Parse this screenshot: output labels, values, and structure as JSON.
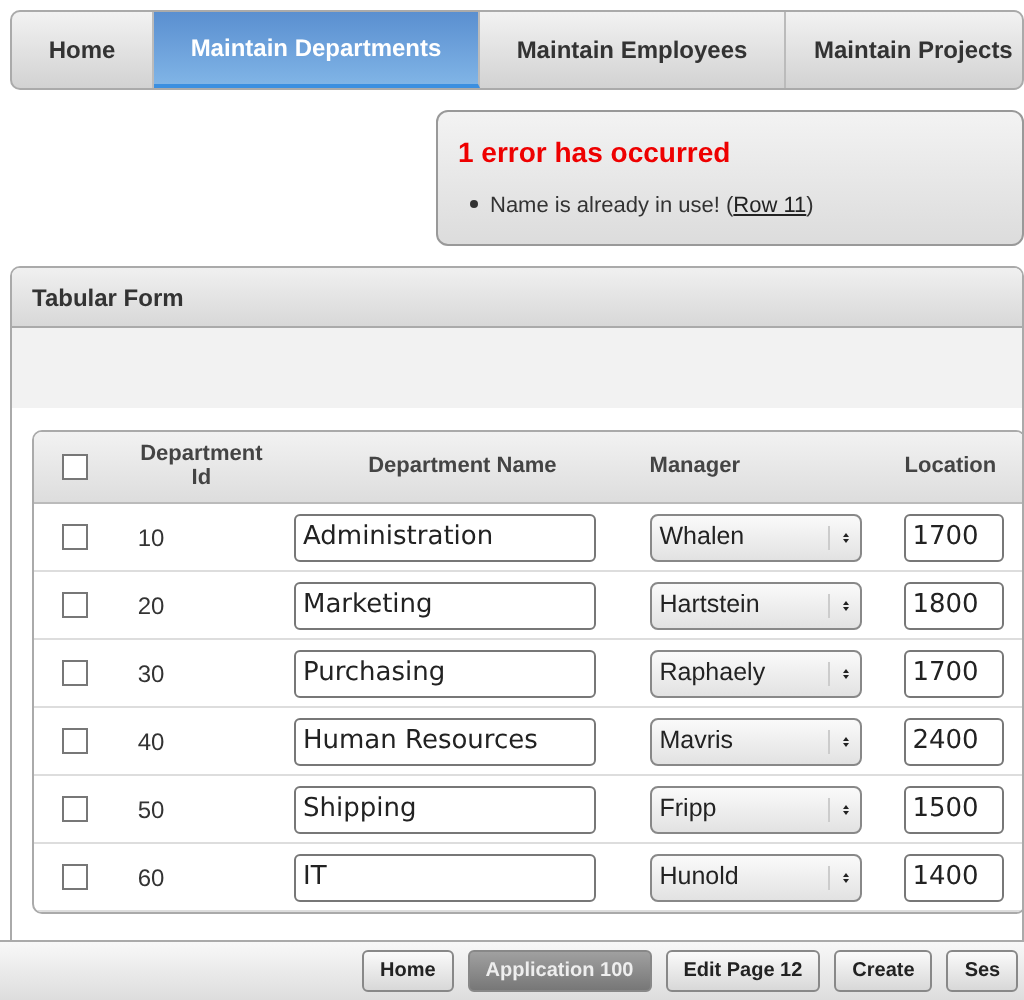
{
  "tabs": [
    {
      "label": "Home",
      "selected": false
    },
    {
      "label": "Maintain Departments",
      "selected": true
    },
    {
      "label": "Maintain Employees",
      "selected": false
    },
    {
      "label": "Maintain Projects",
      "selected": false
    }
  ],
  "error": {
    "title": "1 error has occurred",
    "messages": [
      {
        "text": "Name is already in use! (",
        "link": "Row 11",
        "after": ")"
      }
    ]
  },
  "region": {
    "title": "Tabular Form",
    "table": {
      "header_checked": false,
      "columns": [
        "Department Id",
        "Department Name",
        "Manager",
        "Location"
      ],
      "rows": [
        {
          "checked": false,
          "id": "10",
          "name": "Administration",
          "manager": "Whalen",
          "location": "1700"
        },
        {
          "checked": false,
          "id": "20",
          "name": "Marketing",
          "manager": "Hartstein",
          "location": "1800"
        },
        {
          "checked": false,
          "id": "30",
          "name": "Purchasing",
          "manager": "Raphaely",
          "location": "1700"
        },
        {
          "checked": false,
          "id": "40",
          "name": "Human Resources",
          "manager": "Mavris",
          "location": "2400"
        },
        {
          "checked": false,
          "id": "50",
          "name": "Shipping",
          "manager": "Fripp",
          "location": "1500"
        },
        {
          "checked": false,
          "id": "60",
          "name": "IT",
          "manager": "Hunold",
          "location": "1400"
        }
      ]
    }
  },
  "developer_toolbar": [
    {
      "label": "Home",
      "selected": false
    },
    {
      "label": "Application 100",
      "selected": true
    },
    {
      "label": "Edit Page 12",
      "selected": false
    },
    {
      "label": "Create",
      "selected": false
    },
    {
      "label": "Ses",
      "selected": false
    }
  ]
}
